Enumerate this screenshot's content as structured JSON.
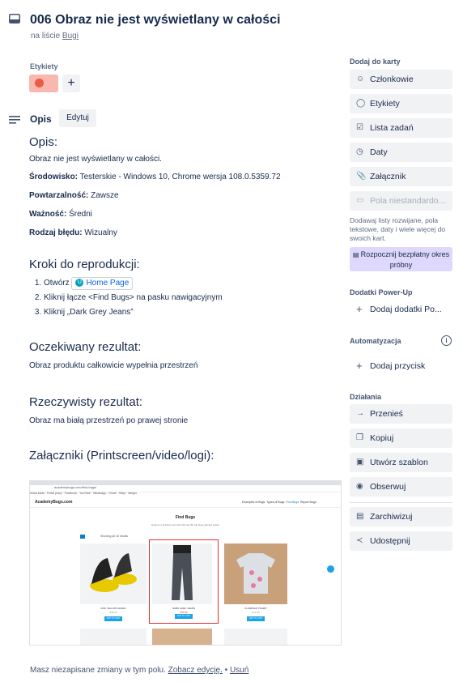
{
  "card": {
    "title": "006 Obraz nie jest wyświetlany w całości",
    "list_prefix": "na liście",
    "list_name": "Bugi"
  },
  "labels": {
    "heading": "Etykiety",
    "add": "+"
  },
  "description": {
    "heading": "Opis",
    "edit_label": "Edytuj",
    "sections": {
      "opis_title": "Opis:",
      "opis_text": "Obraz nie jest wyświetlany w całości.",
      "env_label": "Środowisko:",
      "env_value": " Testerskie - Windows 10, Chrome wersja 108.0.5359.72",
      "rep_label": "Powtarzalność:",
      "rep_value": " Zawsze",
      "sev_label": "Ważność:",
      "sev_value": " Średni",
      "type_label": "Rodzaj błędu:",
      "type_value": " Wizualny",
      "steps_title": "Kroki do reprodukcji:",
      "step1_prefix": "Otwórz ",
      "step1_link": "Home Page",
      "step2": "Kliknij łącze <Find Bugs> na pasku nawigacyjnym",
      "step3": "Kliknij „Dark Grey Jeans”",
      "expected_title": "Oczekiwany rezultat:",
      "expected_text": "Obraz produktu całkowicie wypełnia przestrzeń",
      "actual_title": "Rzeczywisty rezultat:",
      "actual_text": "Obraz ma białą przestrzeń po prawej stronie",
      "attach_title": "Załączniki (Printscreen/video/logi):"
    }
  },
  "attachment": {
    "url": "academybugs.com/find-bugs/",
    "bookmarks": [
      "Nowa karta",
      "Portal pracy",
      "Facebook",
      "YouTube",
      "WhatsApp",
      "Gmail",
      "Sklep",
      "Allegro"
    ],
    "logo": "AcademyBugs.com",
    "nav": [
      "Examples of Bugs",
      "Types of Bugs",
      "Find Bugs",
      "Report Bugs"
    ],
    "page_title": "Find Bugs",
    "page_sub": "Explore a practice test site that has 25 real bugs planted inside",
    "showing": "Showing all 18 results",
    "products": [
      {
        "name": "DNK YELLOW SHOES",
        "price": "$45.00",
        "btn": "ADD TO CART"
      },
      {
        "name": "DARK GREY JEANS",
        "price": "$35.00",
        "btn": "ADD TO CART"
      },
      {
        "name": "FLAMINGO TSHIRT",
        "price": "$12.00",
        "btn": "ADD TO CART"
      }
    ]
  },
  "footer": {
    "text": "Masz niezapisane zmiany w tym polu. ",
    "view_link": "Zobacz edycję.",
    "sep": " • ",
    "discard_link": "Usuń"
  },
  "sidebar": {
    "add_heading": "Dodaj do karty",
    "members": "Członkowie",
    "labels": "Etykiety",
    "checklist": "Lista zadań",
    "dates": "Daty",
    "attachment": "Załącznik",
    "custom_fields": "Pola niestandardo...",
    "custom_note": "Dodawaj listy rozwijane, pola tekstowe, daty i wiele więcej do swoich kart.",
    "trial": "Rozpocznij bezpłatny okres próbny",
    "powerups_heading": "Dodatki Power-Up",
    "add_powerup": "Dodaj dodatki Po...",
    "automation_heading": "Automatyzacja",
    "add_button": "Dodaj przycisk",
    "actions_heading": "Działania",
    "move": "Przenieś",
    "copy": "Kopiuj",
    "template": "Utwórz szablon",
    "watch": "Obserwuj",
    "archive": "Zarchiwizuj",
    "share": "Udostępnij"
  },
  "colors": {
    "label_red": "#eb5a46",
    "label_bg": "#f8b8b0",
    "trial_bg": "#dfd8fd",
    "highlight_red": "#e03131"
  }
}
